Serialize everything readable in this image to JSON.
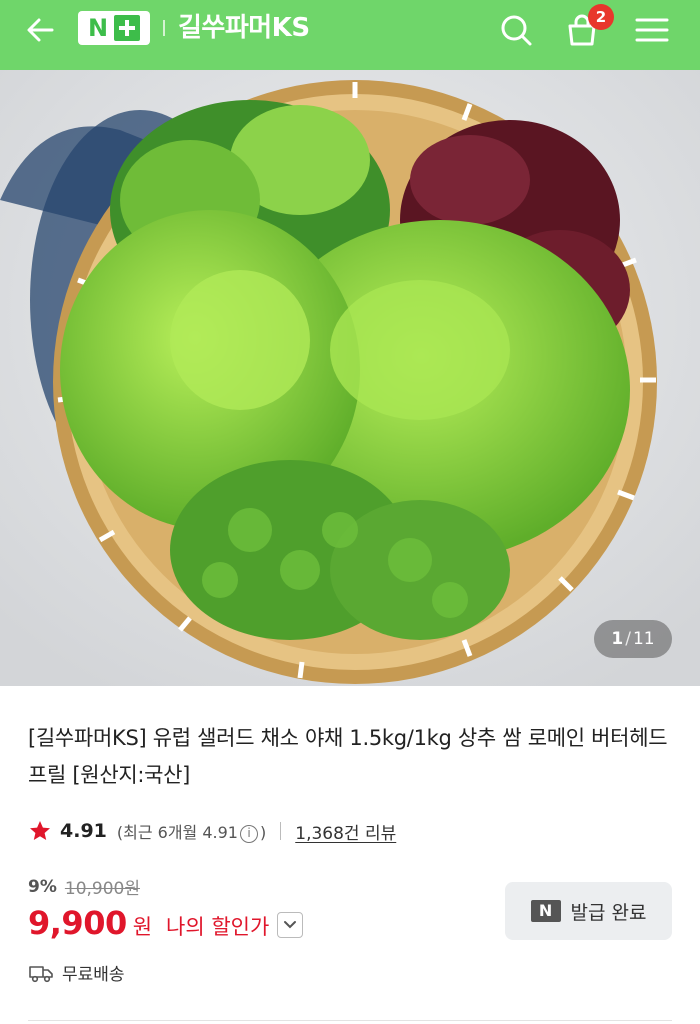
{
  "header": {
    "logo_text": "N",
    "store_name": "길쑤파머KS",
    "cart_count": "2",
    "colors": {
      "background": "#6fd66a",
      "badge": "#e8372c"
    },
    "icons": [
      "back-arrow-icon",
      "search-icon",
      "cart-icon",
      "menu-icon"
    ]
  },
  "gallery": {
    "current": "1",
    "separator": "/",
    "total": "11"
  },
  "product": {
    "title": "[길쑤파머KS] 유럽 샐러드 채소 야채 1.5kg/1kg 상추 쌈 로메인 버터헤드 프릴 [원산지:국산]",
    "rating": "4.91",
    "recent_prefix": "(최근 6개월 4.91",
    "recent_suffix": ")",
    "info_glyph": "i",
    "review_count": "1,368건 리뷰",
    "discount_rate": "9%",
    "original_price": "10,900원",
    "sale_price": "9,900",
    "currency": "원",
    "my_price_label": "나의 할인가",
    "coupon_label": "발급 완료",
    "coupon_icon_text": "N",
    "shipping": "무료배송"
  },
  "colors": {
    "sale": "#e0162b",
    "star": "#e0162b"
  }
}
